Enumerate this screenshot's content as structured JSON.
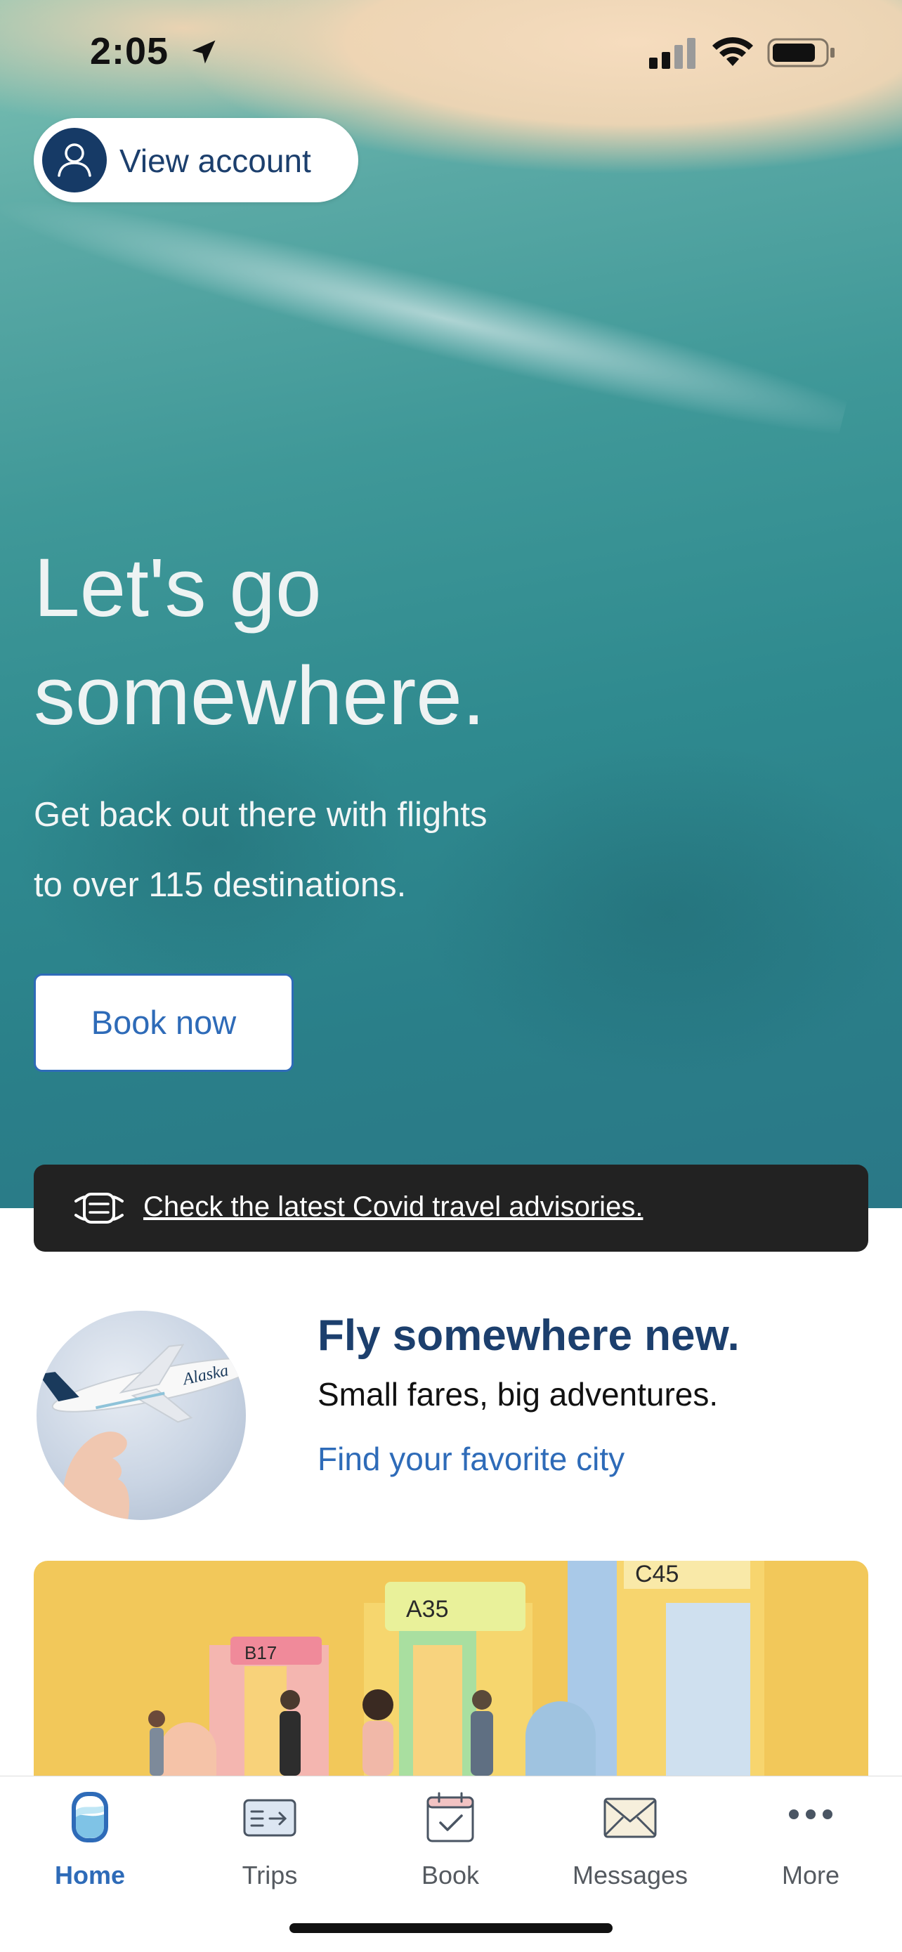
{
  "status_bar": {
    "time": "2:05"
  },
  "account": {
    "label": "View account"
  },
  "hero": {
    "title_line1": "Let's go",
    "title_line2": "somewhere.",
    "subtitle_line1": "Get back out there with flights",
    "subtitle_line2": "to over 115 destinations.",
    "button_label": "Book now"
  },
  "covid": {
    "text": "Check the latest Covid travel advisories."
  },
  "promo": {
    "title": "Fly somewhere new.",
    "subtitle": "Small fares, big adventures.",
    "link": "Find your favorite city"
  },
  "gate_card": {
    "gates": [
      "B17",
      "A35",
      "C45"
    ]
  },
  "tabs": [
    {
      "label": "Home",
      "icon": "home-window-icon",
      "active": true
    },
    {
      "label": "Trips",
      "icon": "boarding-pass-icon",
      "active": false
    },
    {
      "label": "Book",
      "icon": "calendar-check-icon",
      "active": false
    },
    {
      "label": "Messages",
      "icon": "envelope-icon",
      "active": false
    },
    {
      "label": "More",
      "icon": "more-dots-icon",
      "active": false
    }
  ],
  "colors": {
    "brand_navy": "#1c3f6d",
    "brand_blue": "#2e6bb8",
    "banner_dark": "#222222",
    "card_yellow": "#f2c85a"
  }
}
